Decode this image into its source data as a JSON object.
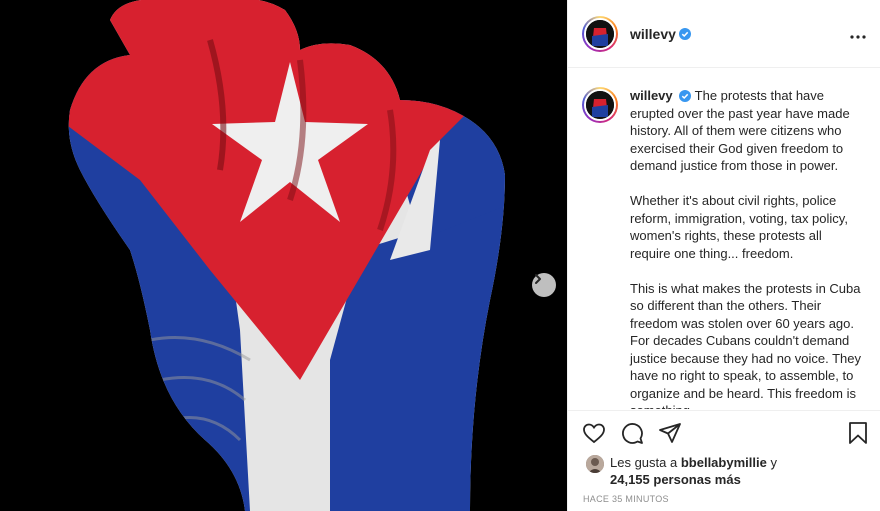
{
  "post": {
    "username": "willevy",
    "verified": true,
    "more_icon": "ellipsis-icon",
    "caption_paragraphs": [
      "The protests that have erupted over the past year have made history. All of them were citizens who exercised their God given freedom to demand justice from those in power.",
      "Whether it's about civil rights, police reform, immigration, voting, tax policy, women's rights, these protests all require one thing... freedom.",
      "This is what makes the protests in Cuba so different than the others. Their freedom was stolen over 60 years ago. For decades Cubans couldn't demand justice because they had no voice. They have no right to speak, to assemble, to organize and be heard. This freedom is something"
    ],
    "likes_prefix": "Les gusta a",
    "likes_user": "bbellabymillie",
    "likes_suffix": "y",
    "likes_count": "24,155 personas más",
    "timestamp": "HACE 35 MINUTOS"
  },
  "media": {
    "description_colors": {
      "red": "#d7212f",
      "blue": "#1f3fa0",
      "white": "#e6e6e6"
    },
    "next_icon": "chevron-right-icon"
  },
  "actions": {
    "icons": [
      "heart-icon",
      "comment-icon",
      "share-icon",
      "bookmark-icon"
    ]
  }
}
